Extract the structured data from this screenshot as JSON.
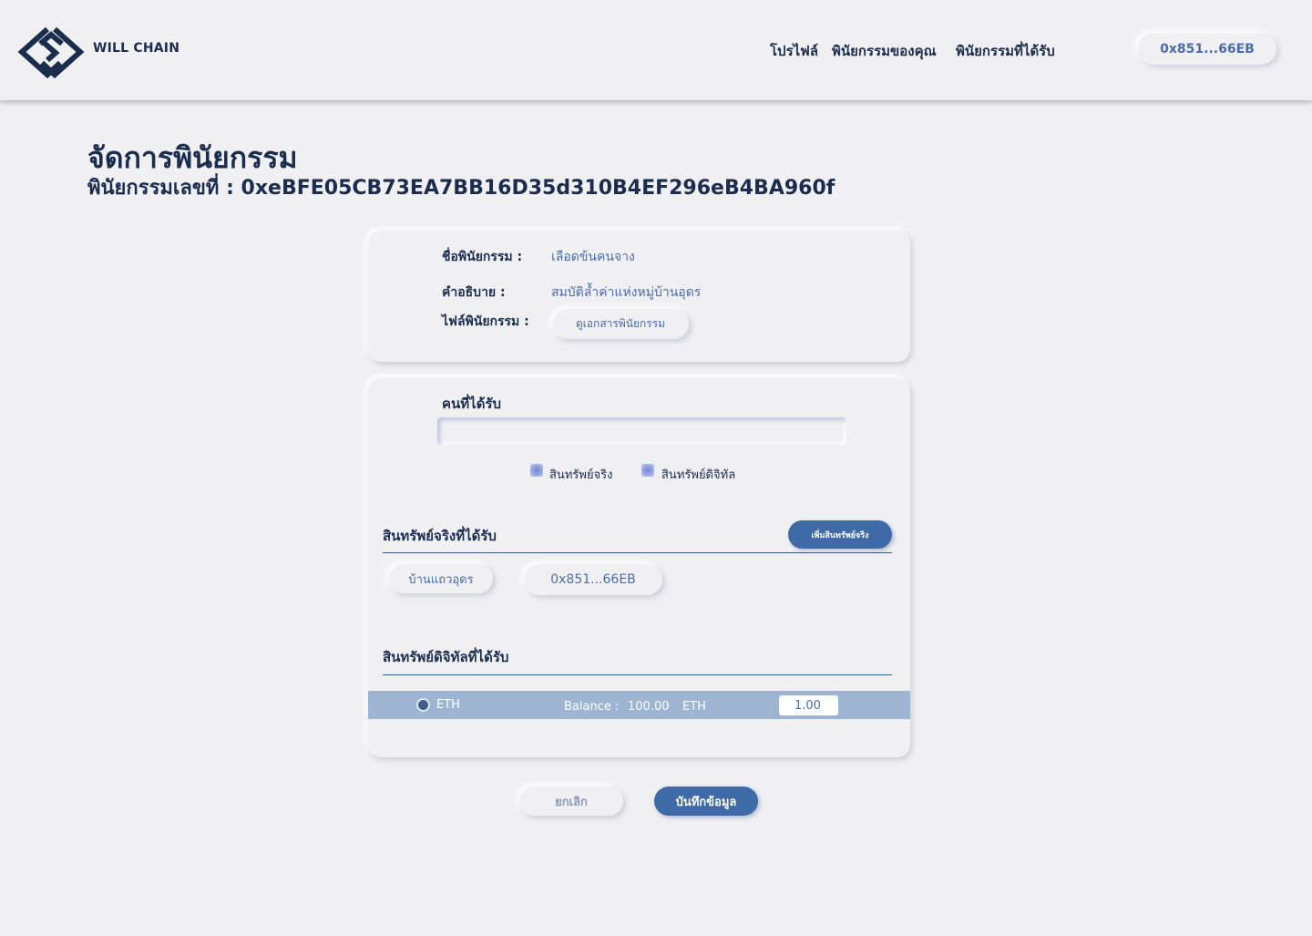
{
  "header": {
    "logo_text": "WILL CHAIN",
    "nav": [
      "โปรไฟล์",
      "พินัยกรรมของคุณ",
      "พินัยกรรมที่ได้รับ"
    ],
    "wallet_address": "0x851...66EB"
  },
  "page": {
    "title": "จัดการพินัยกรรม",
    "subtitle": "พินัยกรรมเลขที่ : 0xeBFE05CB73EA7BB16D35d310B4EF296eB4BA960f"
  },
  "will_info": {
    "name_label": "ชื่อพินัยกรรม :",
    "name_value": "เลือดข้นคนจาง",
    "description_label": "คำอธิบาย :",
    "description_value": "สมบัติล้ำค่าแห่งหมู่บ้านอุดร",
    "file_label": "ไฟล์พินัยกรรม :",
    "file_button": "ดูเอกสารพินัยกรรม"
  },
  "recipient": {
    "label": "คนที่ได้รับ",
    "input_value": "",
    "checkbox_real": "สินทรัพย์จริง",
    "checkbox_digital": "สินทรัพย์ดิจิทัล"
  },
  "real_assets": {
    "title": "สินทรัพย์จริงที่ได้รับ",
    "add_button": "เพิ่มสินทรัพย์จริง",
    "items": [
      "บ้านแถวอุดร",
      "0x851...66EB"
    ]
  },
  "digital_assets": {
    "title": "สินทรัพย์ดิจิทัลที่ได้รับ",
    "token": "ETH",
    "balance_label": "Balance :",
    "balance_value": "100.00",
    "balance_unit": "ETH",
    "amount_value": "1.00"
  },
  "actions": {
    "cancel": "ยกเลิก",
    "save": "บันทึกข้อมูล"
  },
  "colors": {
    "background": "#f0f0f3",
    "primary": "#3e6aa8",
    "text_dark": "#1b2d4f",
    "text_accent": "#4a6da8",
    "eth_row": "#9db4d3"
  }
}
